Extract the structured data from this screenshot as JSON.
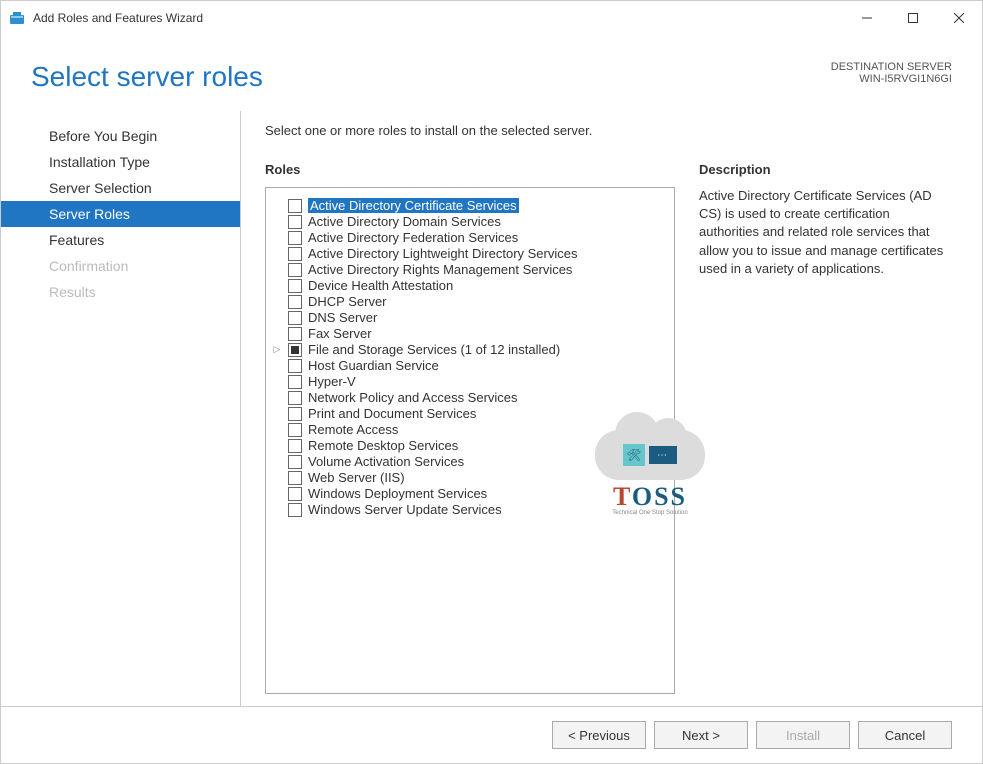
{
  "window": {
    "title": "Add Roles and Features Wizard"
  },
  "header": {
    "page_title": "Select server roles",
    "dest_label": "DESTINATION SERVER",
    "dest_name": "WIN-I5RVGI1N6GI"
  },
  "sidebar": {
    "items": [
      {
        "label": "Before You Begin",
        "state": "enabled"
      },
      {
        "label": "Installation Type",
        "state": "enabled"
      },
      {
        "label": "Server Selection",
        "state": "enabled"
      },
      {
        "label": "Server Roles",
        "state": "active"
      },
      {
        "label": "Features",
        "state": "enabled"
      },
      {
        "label": "Confirmation",
        "state": "disabled"
      },
      {
        "label": "Results",
        "state": "disabled"
      }
    ]
  },
  "main": {
    "instruction": "Select one or more roles to install on the selected server.",
    "roles_label": "Roles",
    "roles": [
      {
        "label": "Active Directory Certificate Services",
        "checked": false,
        "selected": true,
        "expandable": false
      },
      {
        "label": "Active Directory Domain Services",
        "checked": false,
        "selected": false,
        "expandable": false
      },
      {
        "label": "Active Directory Federation Services",
        "checked": false,
        "selected": false,
        "expandable": false
      },
      {
        "label": "Active Directory Lightweight Directory Services",
        "checked": false,
        "selected": false,
        "expandable": false
      },
      {
        "label": "Active Directory Rights Management Services",
        "checked": false,
        "selected": false,
        "expandable": false
      },
      {
        "label": "Device Health Attestation",
        "checked": false,
        "selected": false,
        "expandable": false
      },
      {
        "label": "DHCP Server",
        "checked": false,
        "selected": false,
        "expandable": false
      },
      {
        "label": "DNS Server",
        "checked": false,
        "selected": false,
        "expandable": false
      },
      {
        "label": "Fax Server",
        "checked": false,
        "selected": false,
        "expandable": false
      },
      {
        "label": "File and Storage Services (1 of 12 installed)",
        "checked": "partial",
        "selected": false,
        "expandable": true
      },
      {
        "label": "Host Guardian Service",
        "checked": false,
        "selected": false,
        "expandable": false
      },
      {
        "label": "Hyper-V",
        "checked": false,
        "selected": false,
        "expandable": false
      },
      {
        "label": "Network Policy and Access Services",
        "checked": false,
        "selected": false,
        "expandable": false
      },
      {
        "label": "Print and Document Services",
        "checked": false,
        "selected": false,
        "expandable": false
      },
      {
        "label": "Remote Access",
        "checked": false,
        "selected": false,
        "expandable": false
      },
      {
        "label": "Remote Desktop Services",
        "checked": false,
        "selected": false,
        "expandable": false
      },
      {
        "label": "Volume Activation Services",
        "checked": false,
        "selected": false,
        "expandable": false
      },
      {
        "label": "Web Server (IIS)",
        "checked": false,
        "selected": false,
        "expandable": false
      },
      {
        "label": "Windows Deployment Services",
        "checked": false,
        "selected": false,
        "expandable": false
      },
      {
        "label": "Windows Server Update Services",
        "checked": false,
        "selected": false,
        "expandable": false
      }
    ],
    "desc_label": "Description",
    "desc_text": "Active Directory Certificate Services (AD CS) is used to create certification authorities and related role services that allow you to issue and manage certificates used in a variety of applications."
  },
  "footer": {
    "previous": "< Previous",
    "next": "Next >",
    "install": "Install",
    "cancel": "Cancel"
  },
  "watermark": {
    "text": "TOSS",
    "sub": "Technical One Stop Solution"
  }
}
